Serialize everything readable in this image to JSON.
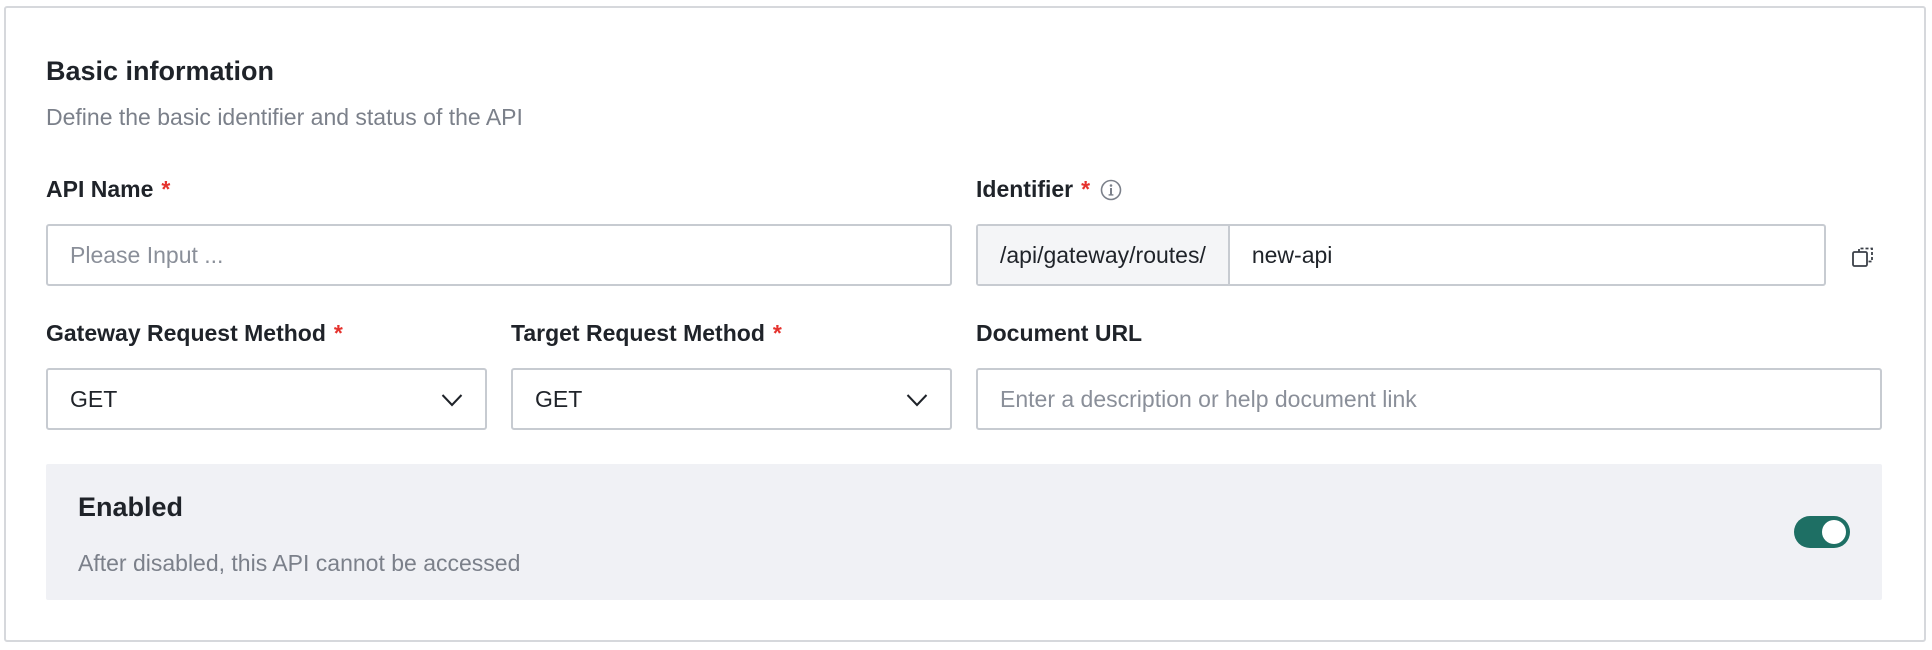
{
  "section": {
    "title": "Basic information",
    "description": "Define the basic identifier and status of the API"
  },
  "required_mark": "*",
  "api_name": {
    "label": "API Name",
    "placeholder": "Please Input ...",
    "value": ""
  },
  "identifier": {
    "label": "Identifier",
    "prefix": "/api/gateway/routes/",
    "value": "new-api",
    "info_icon": "info-icon",
    "copy_icon": "copy-icon"
  },
  "gateway_method": {
    "label": "Gateway Request Method",
    "selected": "GET"
  },
  "target_method": {
    "label": "Target Request Method",
    "selected": "GET"
  },
  "document_url": {
    "label": "Document URL",
    "placeholder": "Enter a description or help document link"
  },
  "enabled": {
    "title": "Enabled",
    "description": "After disabled, this API cannot be accessed",
    "on": true
  },
  "colors": {
    "accent": "#1e6f64",
    "required": "#e5322d",
    "panel_bg": "#f0f1f5",
    "border": "#c7cbd1"
  }
}
